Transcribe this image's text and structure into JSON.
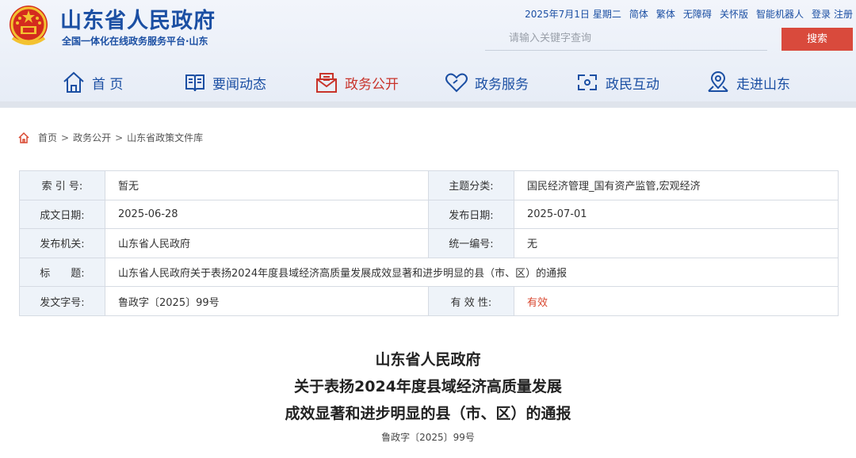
{
  "header": {
    "site_title": "山东省人民政府",
    "site_subtitle": "全国一体化在线政务服务平台·山东",
    "emblem_icon": "national-emblem-icon",
    "toplinks": {
      "date": "2025年7月1日",
      "weekday": "星期二",
      "simplified": "简体",
      "traditional": "繁体",
      "accessibility": "无障碍",
      "elderly": "关怀版",
      "robot": "智能机器人",
      "login": "登录",
      "register": "注册"
    },
    "search": {
      "placeholder": "请输入关键字查询",
      "button_label": "搜索"
    },
    "colors": {
      "brand": "#1b4fa3",
      "accent": "#d94a3c"
    }
  },
  "nav": {
    "items": [
      {
        "label": "首 页",
        "icon": "home-icon"
      },
      {
        "label": "要闻动态",
        "icon": "newspaper-icon"
      },
      {
        "label": "政务公开",
        "icon": "envelope-icon",
        "active": true
      },
      {
        "label": "政务服务",
        "icon": "heart-icon"
      },
      {
        "label": "政民互动",
        "icon": "interaction-icon"
      },
      {
        "label": "走进山东",
        "icon": "map-pin-icon"
      }
    ]
  },
  "breadcrumb": {
    "items": [
      "首页",
      "政务公开",
      "山东省政策文件库"
    ],
    "separator": ">"
  },
  "info": {
    "index_label": "索 引 号:",
    "index_value": "暂无",
    "topic_label": "主题分类:",
    "topic_value": "国民经济管理_国有资产监管,宏观经济",
    "written_label": "成文日期:",
    "written_value": "2025-06-28",
    "published_label": "发布日期:",
    "published_value": "2025-07-01",
    "issuer_label": "发布机关:",
    "issuer_value": "山东省人民政府",
    "serial_label": "统一编号:",
    "serial_value": "无",
    "title_label": "标　　题:",
    "title_value": "山东省人民政府关于表扬2024年度县域经济高质量发展成效显著和进步明显的县（市、区）的通报",
    "docno_label": "发文字号:",
    "docno_value": "鲁政字〔2025〕99号",
    "validity_label": "有 效 性:",
    "validity_value": "有效"
  },
  "document": {
    "title_lines": [
      "山东省人民政府",
      "关于表扬2024年度县域经济高质量发展",
      "成效显著和进步明显的县（市、区）的通报"
    ],
    "doc_number": "鲁政字〔2025〕99号"
  }
}
